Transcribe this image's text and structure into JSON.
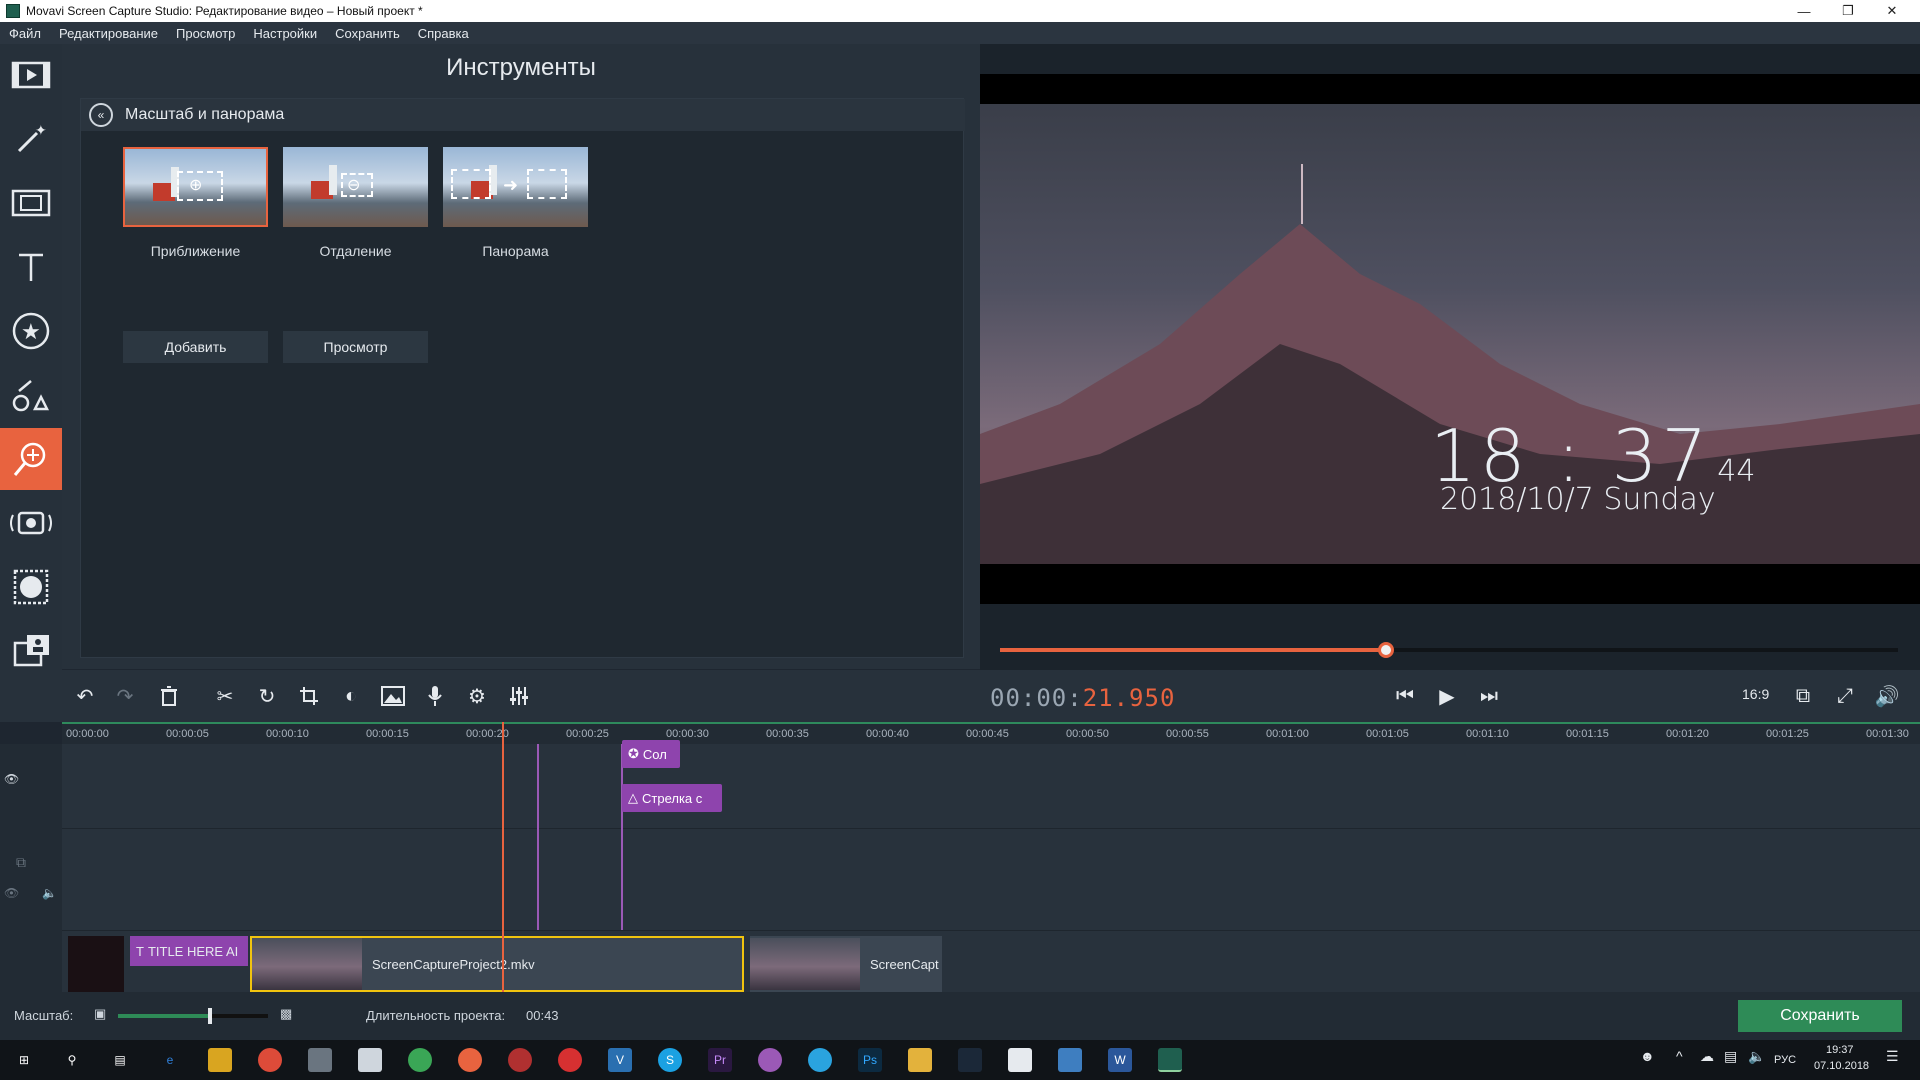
{
  "window": {
    "title": "Movavi Screen Capture Studio: Редактирование видео – Новый проект *"
  },
  "menu": [
    "Файл",
    "Редактирование",
    "Просмотр",
    "Настройки",
    "Сохранить",
    "Справка"
  ],
  "tools": {
    "title": "Инструменты",
    "section": "Масштаб и панорама",
    "effects": [
      {
        "label": "Приближение"
      },
      {
        "label": "Отдаление"
      },
      {
        "label": "Панорама"
      }
    ],
    "add_button": "Добавить",
    "preview_button": "Просмотр"
  },
  "preview": {
    "clock_time": "18 : 37",
    "clock_seconds": "44",
    "clock_date": "2018/10/7 Sunday",
    "progress": 0.43
  },
  "player": {
    "timecode_dim": "00:00:",
    "timecode_bright": "21.950",
    "aspect": "16:9"
  },
  "ruler": {
    "ticks": [
      "00:00:00",
      "00:00:05",
      "00:00:10",
      "00:00:15",
      "00:00:20",
      "00:00:25",
      "00:00:30",
      "00:00:35",
      "00:00:40",
      "00:00:45",
      "00:00:50",
      "00:00:55",
      "00:01:00",
      "00:01:05",
      "00:01:10",
      "00:01:15",
      "00:01:20",
      "00:01:25",
      "00:01:30"
    ]
  },
  "timeline": {
    "tag_sticker": "Сол",
    "tag_arrow": "Стрелка с",
    "title_clip": "TITLE HERE AI",
    "clip_main": "ScreenCaptureProject2.mkv",
    "clip_second": "ScreenCapt"
  },
  "status": {
    "scale_label": "Масштаб:",
    "duration_label": "Длительность проекта:",
    "duration_value": "00:43",
    "save_button": "Сохранить",
    "zoom_level": 0.61
  },
  "taskbar": {
    "lang": "РУС",
    "time": "19:37",
    "date": "07.10.2018"
  },
  "colors": {
    "accent": "#e8633f",
    "save": "#2e8b57",
    "purple": "#8e44ad"
  }
}
